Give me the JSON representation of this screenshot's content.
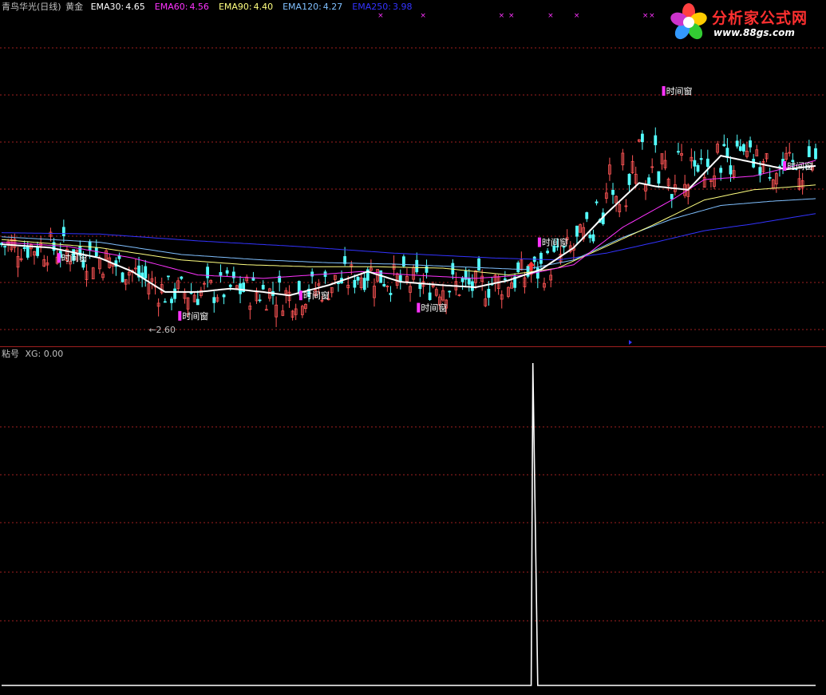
{
  "header": {
    "stock_name": "青鸟华光(日线)",
    "indicator_name": "黄金",
    "ema_items": [
      {
        "label": "EMA30:",
        "value": "4.65",
        "color": "#ffffff"
      },
      {
        "label": "EMA60:",
        "value": "4.56",
        "color": "#ff33ff"
      },
      {
        "label": "EMA90:",
        "value": "4.40",
        "color": "#ffff80"
      },
      {
        "label": "EMA120:",
        "value": "4.27",
        "color": "#80c0ff"
      },
      {
        "label": "EMA250:",
        "value": "3.98",
        "color": "#3333ff"
      }
    ]
  },
  "sub_panel": {
    "title": "粘号",
    "xg_label": "XG:",
    "xg_value": "0.00"
  },
  "logo": {
    "title": "分析家公式网",
    "url": "www.88gs.com"
  },
  "chart_data": [
    {
      "type": "line",
      "panel": "main-price",
      "y_range": [
        2.3,
        7.1
      ],
      "bars": 250,
      "min_label": "2.60",
      "window_label": "时间窗",
      "window_marks": [
        {
          "bar": 18,
          "price": 3.55
        },
        {
          "bar": 55,
          "price": 2.7
        },
        {
          "bar": 92,
          "price": 3.0
        },
        {
          "bar": 128,
          "price": 2.82
        },
        {
          "bar": 165,
          "price": 3.78
        },
        {
          "bar": 203,
          "price": 6.0
        },
        {
          "bar": 240,
          "price": 4.9
        }
      ],
      "buy_arrow": {
        "bar": 162,
        "price": 3.5
      },
      "series": [
        {
          "key": "ema30",
          "color": "#ffffff",
          "points": [
            [
              0,
              3.75
            ],
            [
              15,
              3.7
            ],
            [
              30,
              3.55
            ],
            [
              40,
              3.35
            ],
            [
              50,
              3.05
            ],
            [
              60,
              3.05
            ],
            [
              70,
              3.1
            ],
            [
              80,
              3.05
            ],
            [
              88,
              3.0
            ],
            [
              100,
              3.15
            ],
            [
              112,
              3.35
            ],
            [
              122,
              3.2
            ],
            [
              135,
              3.15
            ],
            [
              145,
              3.12
            ],
            [
              155,
              3.22
            ],
            [
              165,
              3.38
            ],
            [
              175,
              3.7
            ],
            [
              185,
              4.2
            ],
            [
              195,
              4.65
            ],
            [
              200,
              4.6
            ],
            [
              210,
              4.55
            ],
            [
              220,
              5.05
            ],
            [
              230,
              4.95
            ],
            [
              240,
              4.85
            ],
            [
              249,
              4.9
            ]
          ]
        },
        {
          "key": "ema60",
          "color": "#ff33ff",
          "points": [
            [
              0,
              3.78
            ],
            [
              20,
              3.72
            ],
            [
              40,
              3.55
            ],
            [
              60,
              3.3
            ],
            [
              80,
              3.25
            ],
            [
              95,
              3.3
            ],
            [
              110,
              3.35
            ],
            [
              125,
              3.3
            ],
            [
              145,
              3.25
            ],
            [
              160,
              3.3
            ],
            [
              175,
              3.45
            ],
            [
              190,
              4.0
            ],
            [
              205,
              4.4
            ],
            [
              215,
              4.7
            ],
            [
              230,
              4.75
            ],
            [
              249,
              4.98
            ]
          ]
        },
        {
          "key": "ema90",
          "color": "#ffff80",
          "points": [
            [
              0,
              3.82
            ],
            [
              30,
              3.7
            ],
            [
              55,
              3.52
            ],
            [
              75,
              3.45
            ],
            [
              95,
              3.42
            ],
            [
              115,
              3.42
            ],
            [
              135,
              3.4
            ],
            [
              155,
              3.3
            ],
            [
              170,
              3.4
            ],
            [
              185,
              3.72
            ],
            [
              200,
              4.05
            ],
            [
              215,
              4.4
            ],
            [
              230,
              4.55
            ],
            [
              249,
              4.62
            ]
          ]
        },
        {
          "key": "ema120",
          "color": "#80c0ff",
          "points": [
            [
              0,
              3.86
            ],
            [
              30,
              3.78
            ],
            [
              55,
              3.6
            ],
            [
              80,
              3.52
            ],
            [
              100,
              3.48
            ],
            [
              120,
              3.46
            ],
            [
              140,
              3.42
            ],
            [
              160,
              3.38
            ],
            [
              175,
              3.52
            ],
            [
              190,
              3.85
            ],
            [
              205,
              4.12
            ],
            [
              220,
              4.32
            ],
            [
              235,
              4.38
            ],
            [
              249,
              4.42
            ]
          ]
        },
        {
          "key": "ema250",
          "color": "#3333ff",
          "points": [
            [
              0,
              3.92
            ],
            [
              30,
              3.9
            ],
            [
              60,
              3.8
            ],
            [
              90,
              3.72
            ],
            [
              120,
              3.62
            ],
            [
              150,
              3.55
            ],
            [
              170,
              3.52
            ],
            [
              185,
              3.62
            ],
            [
              200,
              3.78
            ],
            [
              215,
              3.95
            ],
            [
              230,
              4.05
            ],
            [
              249,
              4.2
            ]
          ]
        }
      ]
    },
    {
      "type": "line",
      "panel": "sub-xg",
      "y_range": [
        0,
        1
      ],
      "series": [
        {
          "key": "xg",
          "color": "#ffffff",
          "points": [
            [
              0,
              0
            ],
            [
              162,
              0
            ],
            [
              163,
              1
            ],
            [
              164,
              0
            ],
            [
              249,
              0
            ]
          ]
        }
      ]
    }
  ]
}
